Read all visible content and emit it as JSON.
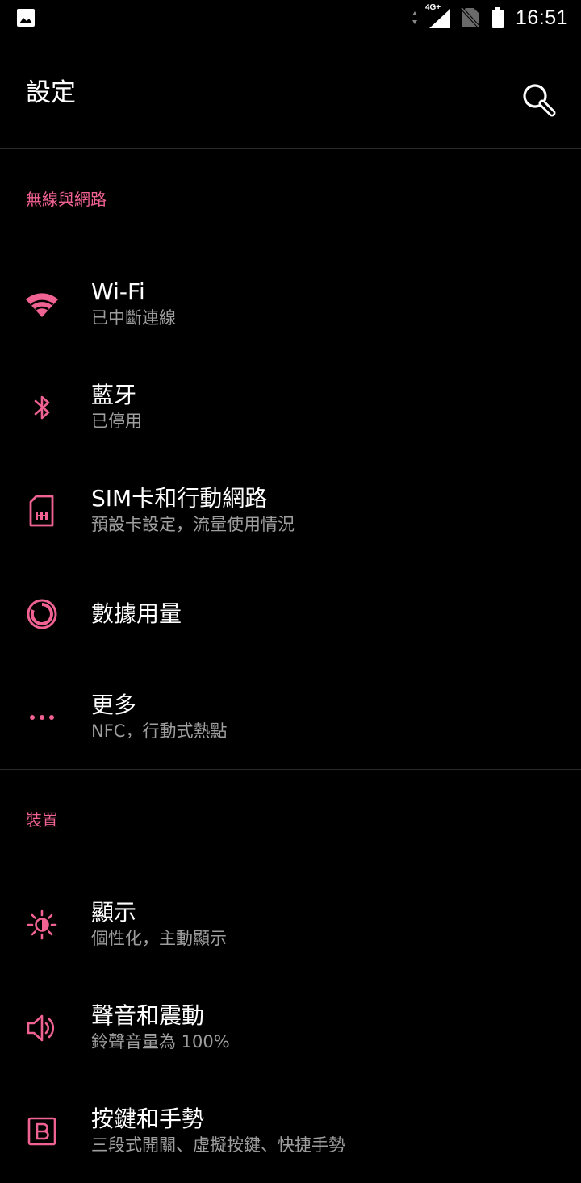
{
  "status_bar": {
    "network_type": "4G+",
    "time": "16:51",
    "icons": [
      "image-icon",
      "data-arrows-icon",
      "signal-icon",
      "no-sim-icon",
      "battery-icon"
    ]
  },
  "app_bar": {
    "title": "設定",
    "search_icon": "search-icon"
  },
  "colors": {
    "accent": "#f06292",
    "background": "#000000",
    "summary_text": "#9e9e9e",
    "divider": "#2a2a2a"
  },
  "sections": [
    {
      "header": "無線與網路",
      "items": [
        {
          "icon": "wifi-icon",
          "title": "Wi-Fi",
          "summary": "已中斷連線"
        },
        {
          "icon": "bluetooth-icon",
          "title": "藍牙",
          "summary": "已停用"
        },
        {
          "icon": "sim-card-icon",
          "title": "SIM卡和行動網路",
          "summary": "預設卡設定，流量使用情況"
        },
        {
          "icon": "data-usage-icon",
          "title": "數據用量",
          "summary": ""
        },
        {
          "icon": "more-icon",
          "title": "更多",
          "summary": "NFC，行動式熱點"
        }
      ]
    },
    {
      "header": "裝置",
      "items": [
        {
          "icon": "brightness-icon",
          "title": "顯示",
          "summary": "個性化，主動顯示"
        },
        {
          "icon": "volume-icon",
          "title": "聲音和震動",
          "summary": "鈴聲音量為 100%"
        },
        {
          "icon": "buttons-icon",
          "title": "按鍵和手勢",
          "summary": "三段式開關、虛擬按鍵、快捷手勢"
        }
      ]
    }
  ]
}
